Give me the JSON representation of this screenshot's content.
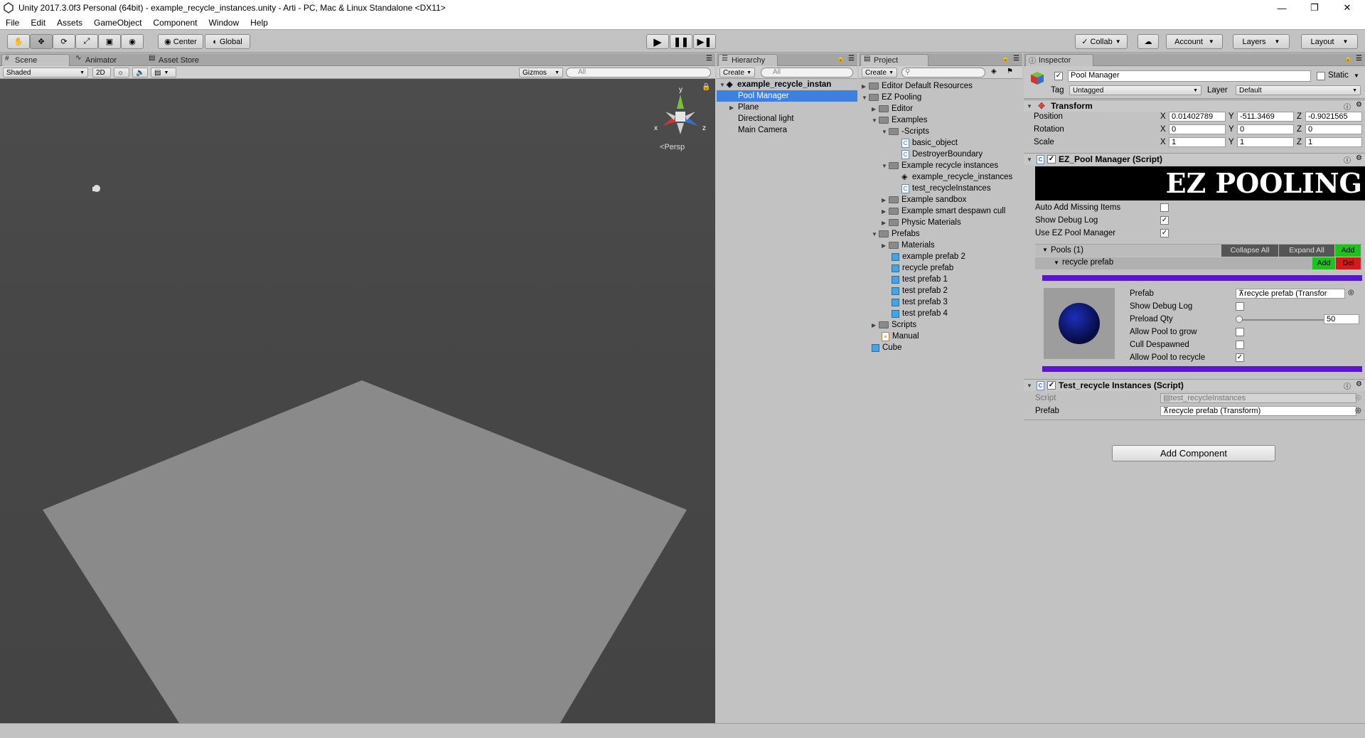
{
  "window": {
    "title": "Unity 2017.3.0f3 Personal (64bit) - example_recycle_instances.unity - Arti - PC, Mac & Linux Standalone <DX11>"
  },
  "menu": [
    "File",
    "Edit",
    "Assets",
    "GameObject",
    "Component",
    "Window",
    "Help"
  ],
  "toolbar": {
    "pivot": "Center",
    "space": "Global",
    "collab": "Collab",
    "account": "Account",
    "layers": "Layers",
    "layout": "Layout"
  },
  "scene": {
    "tabs": [
      "Scene",
      "Animator",
      "Asset Store"
    ],
    "shading": "Shaded",
    "mode2d": "2D",
    "gizmos": "Gizmos",
    "search_placeholder": "All",
    "persp": "Persp",
    "axis_x": "x",
    "axis_y": "y",
    "axis_z": "z"
  },
  "hierarchy": {
    "tab": "Hierarchy",
    "create": "Create",
    "search_placeholder": "All",
    "scene_name": "example_recycle_instan",
    "items": [
      "Pool Manager",
      "Plane",
      "Directional light",
      "Main Camera"
    ]
  },
  "project": {
    "tab": "Project",
    "create": "Create",
    "items": [
      "Editor Default Resources",
      "EZ Pooling",
      "Editor",
      "Examples",
      "-Scripts",
      "basic_object",
      "DestroyerBoundary",
      "Example recycle instances",
      "example_recycle_instances",
      "test_recycleInstances",
      "Example sandbox",
      "Example smart despawn cull",
      "Physic Materials",
      "Prefabs",
      "Materials",
      "example prefab 2",
      "recycle prefab",
      "test prefab 1",
      "test prefab 2",
      "test prefab 3",
      "test prefab 4",
      "Scripts",
      "Manual",
      "Cube"
    ]
  },
  "inspector": {
    "tab": "Inspector",
    "object_name": "Pool Manager",
    "static_label": "Static",
    "tag_label": "Tag",
    "tag_value": "Untagged",
    "layer_label": "Layer",
    "layer_value": "Default",
    "transform": {
      "title": "Transform",
      "position_label": "Position",
      "rotation_label": "Rotation",
      "scale_label": "Scale",
      "position": [
        "0.01402789",
        "-511.3469",
        "-0.9021565"
      ],
      "rotation": [
        "0",
        "0",
        "0"
      ],
      "scale": [
        "1",
        "1",
        "1"
      ],
      "axes": [
        "X",
        "Y",
        "Z"
      ]
    },
    "pool_manager": {
      "title": "EZ_Pool Manager (Script)",
      "banner": "EZ POOLING",
      "auto_add": "Auto Add Missing Items",
      "show_debug": "Show Debug Log",
      "use_ez": "Use EZ Pool Manager",
      "pools_label": "Pools (1)",
      "collapse_all": "Collapse All",
      "expand_all": "Expand All",
      "add": "Add",
      "del": "Del",
      "pool_name": "recycle prefab",
      "prefab_label": "Prefab",
      "prefab_value": "recycle prefab (Transfor",
      "debug_label": "Show Debug Log",
      "preload_label": "Preload Qty",
      "preload_value": "50",
      "preload_fraction": 0.0,
      "grow_label": "Allow Pool to grow",
      "cull_label": "Cull Despawned",
      "recycle_label": "Allow Pool to recycle"
    },
    "test_recycle": {
      "title": "Test_recycle Instances (Script)",
      "script_label": "Script",
      "script_value": "test_recycleInstances",
      "prefab_label": "Prefab",
      "prefab_value": "recycle prefab (Transform)"
    },
    "add_component": "Add Component"
  }
}
